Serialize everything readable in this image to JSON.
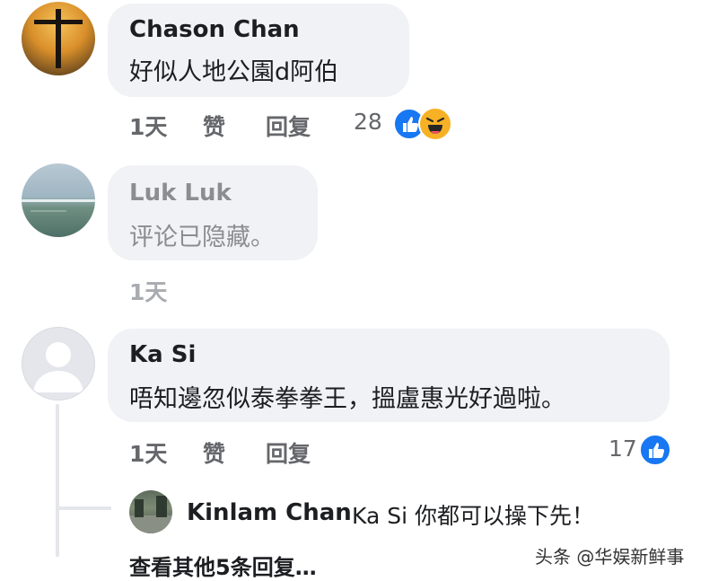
{
  "comments": [
    {
      "author": "Chason Chan",
      "text": "好似人地公園d阿伯",
      "time": "1天",
      "like": "赞",
      "reply": "回复",
      "reaction_count": "28",
      "reactions": [
        "like-icon",
        "haha-icon"
      ]
    },
    {
      "author": "Luk Luk",
      "text": "评论已隐藏。",
      "time": "1天"
    },
    {
      "author": "Ka Si",
      "text": "唔知邊忽似泰拳拳王，搵盧惠光好過啦。",
      "time": "1天",
      "like": "赞",
      "reply": "回复",
      "reaction_count": "17",
      "reactions": [
        "like-icon"
      ]
    }
  ],
  "reply": {
    "author": "Kinlam Chan",
    "text": "Ka Si 你都可以操下先！"
  },
  "more_replies": "查看其他5条回复…",
  "watermark": "头条 @华娱新鲜事",
  "colors": {
    "like_blue": "#1877f2",
    "haha_yellow": "#f7b125",
    "bubble_bg": "#f0f2f5",
    "meta_gray": "#65676b"
  }
}
